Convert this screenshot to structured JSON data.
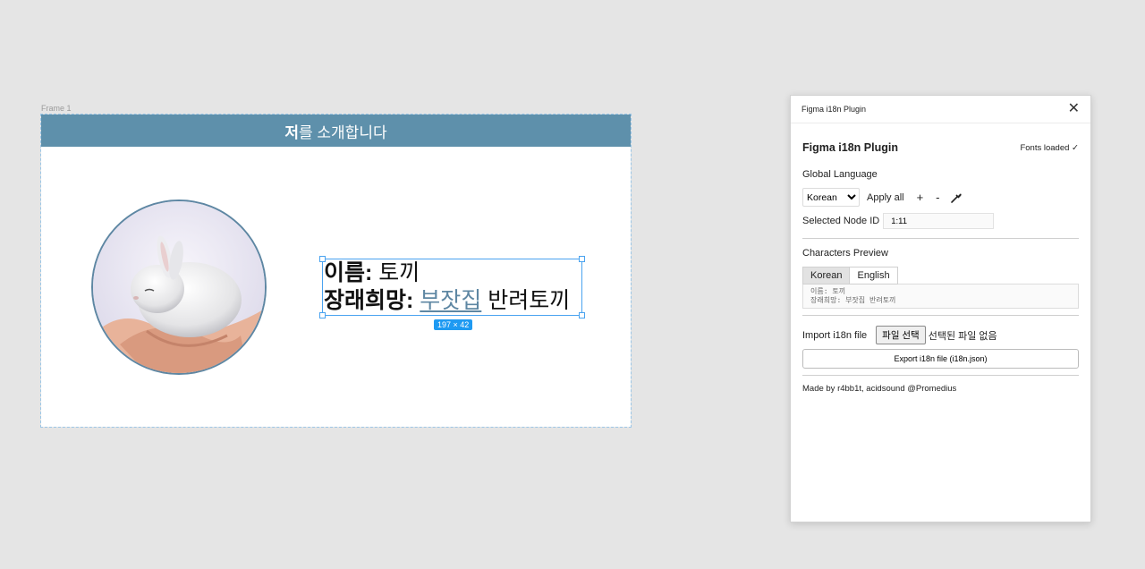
{
  "canvas": {
    "frame_label": "Frame 1",
    "header": {
      "bold": "저",
      "rest": "를 소개합니다"
    },
    "textbox": {
      "line1_label": "이름:",
      "line1_value": "토끼",
      "line2_label": "장래희망:",
      "line2_link": "부잣집",
      "line2_value": "반려토끼"
    },
    "size_badge": "197 × 42"
  },
  "plugin": {
    "window_title": "Figma i18n Plugin",
    "heading": "Figma i18n Plugin",
    "status": "Fonts loaded ✓",
    "global_language": {
      "label": "Global Language",
      "selected": "Korean",
      "apply_all": "Apply all",
      "add": "+",
      "remove": "-",
      "pick_icon": "eyedropper-icon"
    },
    "selected_node": {
      "label": "Selected Node ID",
      "value": "1:11"
    },
    "characters_preview": {
      "label": "Characters Preview",
      "tabs": [
        "Korean",
        "English"
      ],
      "active_tab": "Korean",
      "line1": "이름: 토끼",
      "line2": "장래희망: 부잣집 반려토끼"
    },
    "import": {
      "label": "Import i18n file",
      "button": "파일 선택",
      "status": "선택된 파일 없음"
    },
    "export_button": "Export i18n file (i18n.json)",
    "credits": "Made by r4bb1t, acidsound @Promedius"
  },
  "colors": {
    "header_bg": "#5e90ab",
    "selection": "#4aa3f0",
    "badge": "#1e9af2",
    "link": "#5e87a3"
  }
}
